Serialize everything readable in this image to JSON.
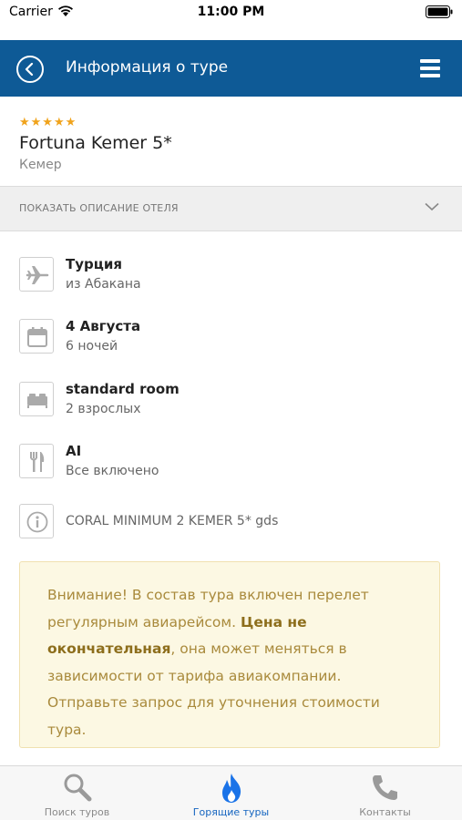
{
  "status_bar": {
    "carrier": "Carrier",
    "time": "11:00 PM"
  },
  "nav": {
    "title": "Информация о туре"
  },
  "hotel": {
    "stars": "★★★★★",
    "name": "Fortuna Kemer 5*",
    "city": "Кемер"
  },
  "description_toggle": {
    "label": "ПОКАЗАТЬ ОПИСАНИЕ ОТЕЛЯ"
  },
  "info": {
    "country": {
      "icon": "airplane-icon",
      "title": "Турция",
      "sub": "из Абакана"
    },
    "date": {
      "icon": "calendar-icon",
      "title": "4 Августа",
      "sub": "6 ночей"
    },
    "room": {
      "icon": "bed-icon",
      "title": "standard room",
      "sub": "2 взрослых"
    },
    "meal": {
      "icon": "fork-knife-icon",
      "title": "AI",
      "sub": "Все включено"
    },
    "tariff": {
      "icon": "info-icon",
      "text": "CORAL MINIMUM 2 KEMER 5* gds"
    }
  },
  "notice": {
    "part1": "Внимание! В состав тура включен перелет регулярным авиарейсом. ",
    "bold": "Цена не окончательная",
    "part2": ", она может меняться в зависимости от тарифа авиакомпании. Отправьте запрос для уточнения стоимости тура."
  },
  "tabs": {
    "search": {
      "label": "Поиск туров",
      "icon": "search-icon"
    },
    "hot": {
      "label": "Горящие туры",
      "icon": "flame-icon"
    },
    "contacts": {
      "label": "Контакты",
      "icon": "phone-icon"
    }
  },
  "colors": {
    "brand": "#0e5a96",
    "stars": "#f0a31c",
    "active_tab": "#1565c0",
    "notice_bg": "#fcf8e3",
    "notice_text": "#a98a3c"
  }
}
